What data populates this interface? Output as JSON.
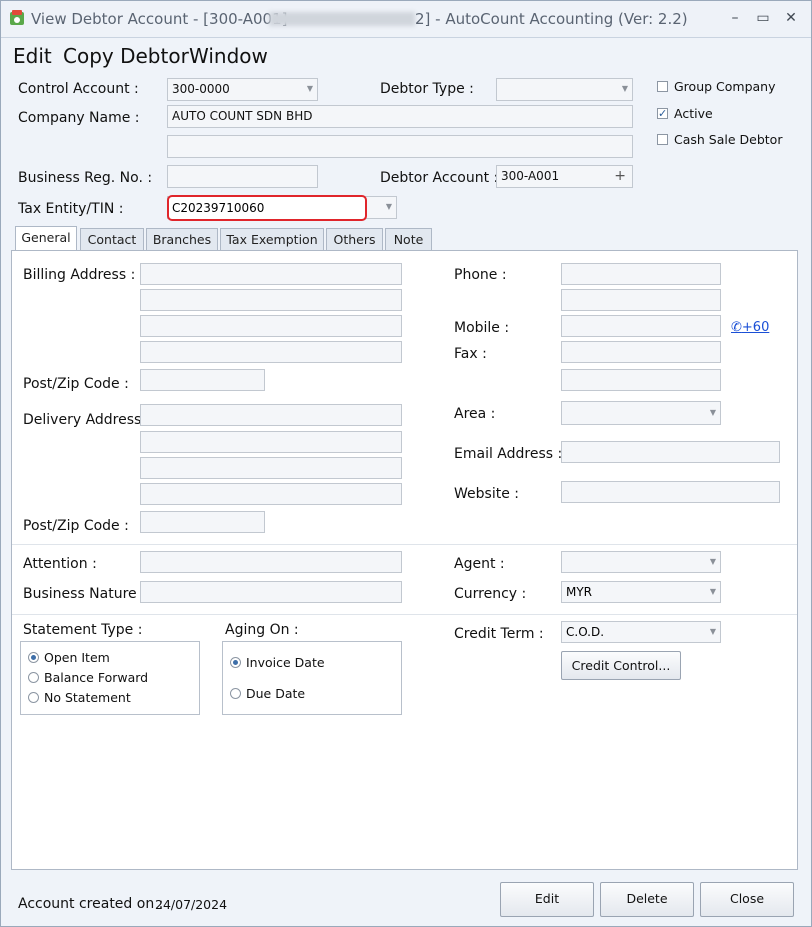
{
  "title": {
    "prefix": "View Debtor Account - [300-A001] -",
    "suffix": "2] - AutoCount Accounting (Ver: 2.2)"
  },
  "window_controls": {
    "minimize": "–",
    "restore": "▭",
    "close": "✕"
  },
  "menu": {
    "edit": "Edit",
    "copy_debtor": "Copy Debtor",
    "window": "Window"
  },
  "header": {
    "control_account_label": "Control Account :",
    "control_account_value": "300-0000",
    "debtor_type_label": "Debtor Type :",
    "debtor_type_value": "",
    "group_company_label": "Group Company",
    "active_label": "Active",
    "cash_sale_label": "Cash Sale Debtor",
    "company_name_label": "Company Name :",
    "company_name_value": "AUTO COUNT SDN BHD",
    "company_name2_value": "",
    "business_reg_label": "Business Reg. No. :",
    "business_reg_value": "",
    "debtor_account_label": "Debtor Account :",
    "debtor_account_value": "300-A001",
    "tax_entity_label": "Tax Entity/TIN :",
    "tax_entity_value": "C20239710060",
    "checkboxes": {
      "group_company": false,
      "active": true,
      "cash_sale": false
    }
  },
  "tabs": [
    "General",
    "Contact",
    "Branches",
    "Tax Exemption",
    "Others",
    "Note"
  ],
  "general": {
    "billing_address_label": "Billing Address :",
    "post_zip_label": "Post/Zip Code :",
    "delivery_address_label": "Delivery Address :",
    "post_zip2_label": "Post/Zip Code :",
    "phone_label": "Phone :",
    "mobile_label": "Mobile :",
    "mobile_link": "+60",
    "fax_label": "Fax :",
    "area_label": "Area :",
    "email_label": "Email  Address :",
    "website_label": "Website :",
    "attention_label": "Attention :",
    "business_nature_label": "Business Nature :",
    "agent_label": "Agent :",
    "currency_label": "Currency :",
    "currency_value": "MYR",
    "statement_type_label": "Statement Type :",
    "statement_options": [
      "Open Item",
      "Balance Forward",
      "No Statement"
    ],
    "statement_selected": "Open Item",
    "aging_on_label": "Aging On :",
    "aging_options": [
      "Invoice Date",
      "Due Date"
    ],
    "aging_selected": "Invoice Date",
    "credit_term_label": "Credit Term :",
    "credit_term_value": "C.O.D.",
    "credit_control_button": "Credit Control..."
  },
  "footer": {
    "created_label": "Account created on :",
    "created_date": "24/07/2024",
    "edit_button": "Edit",
    "delete_button": "Delete",
    "close_button": "Close"
  },
  "colors": {
    "highlight_border": "#e0252b",
    "link": "#1a4fd6",
    "accent": "#3d6ea8"
  }
}
